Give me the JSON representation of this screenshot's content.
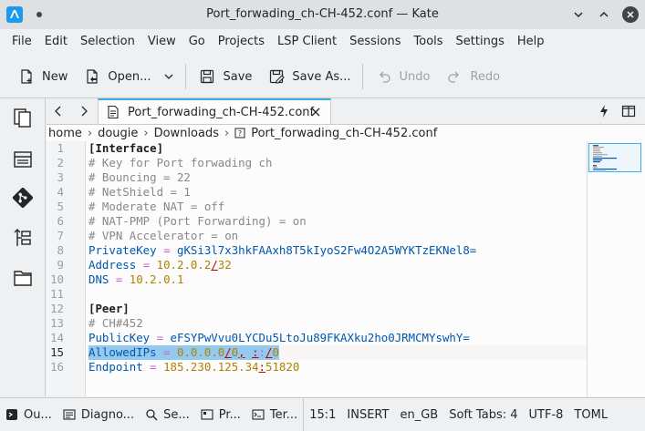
{
  "window": {
    "title": "Port_forwading_ch-CH-452.conf — Kate"
  },
  "menu": [
    "File",
    "Edit",
    "Selection",
    "View",
    "Go",
    "Projects",
    "LSP Client",
    "Sessions",
    "Tools",
    "Settings",
    "Help"
  ],
  "toolbar": {
    "new_label": "New",
    "open_label": "Open...",
    "save_label": "Save",
    "save_as_label": "Save As...",
    "undo_label": "Undo",
    "redo_label": "Redo"
  },
  "tab": {
    "label": "Port_forwading_ch-CH-452.conf"
  },
  "breadcrumb": {
    "parts": [
      "home",
      "dougie",
      "Downloads"
    ],
    "file": "Port_forwading_ch-CH-452.conf"
  },
  "editor": {
    "current_line": 15,
    "line_numbers": [
      "1",
      "2",
      "3",
      "4",
      "5",
      "6",
      "7",
      "8",
      "9",
      "10",
      "11",
      "12",
      "13",
      "14",
      "15",
      "16"
    ]
  },
  "statusbar": {
    "output": "Ou...",
    "diagnostics": "Diagno...",
    "search": "Se...",
    "projects": "Pr...",
    "terminal": "Ter...",
    "cursor": "15:1",
    "mode": "INSERT",
    "dictionary": "en_GB",
    "indent": "Soft Tabs: 4",
    "encoding": "UTF-8",
    "syntax": "TOML"
  },
  "colors": {
    "accent": "#3daee9",
    "selection": "#94caef"
  }
}
